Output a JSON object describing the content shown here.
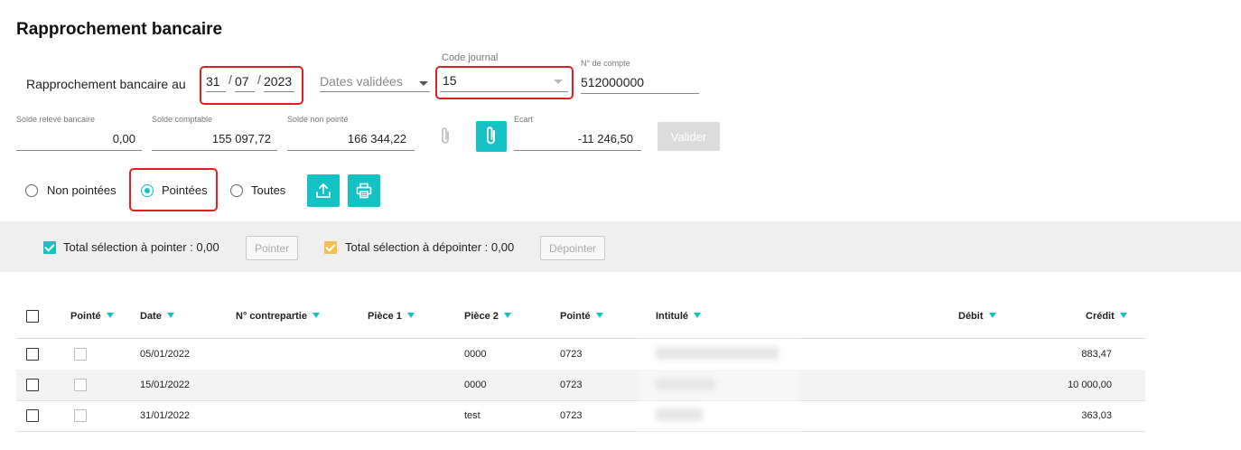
{
  "title": "Rapprochement bancaire",
  "header": {
    "label": "Rapprochement bancaire au",
    "date": {
      "day": "31",
      "month": "07",
      "year": "2023"
    },
    "dates_select_placeholder": "Dates validées",
    "code_journal_label": "Code journal",
    "code_journal_value": "15",
    "numero_compte_label": "N° de compte",
    "numero_compte_value": "512000000"
  },
  "soldes": {
    "releve_label": "Solde relevé bancaire",
    "releve_value": "0,00",
    "comptable_label": "Solde comptable",
    "comptable_value": "155 097,72",
    "non_pointe_label": "Solde non pointé",
    "non_pointe_value": "166 344,22",
    "ecart_label": "Ecart",
    "ecart_value": "-11 246,50",
    "valider_label": "Valider"
  },
  "filters": {
    "non_pointees": "Non pointées",
    "pointees": "Pointées",
    "toutes": "Toutes",
    "selected": "pointees"
  },
  "selection_bar": {
    "total_pointer": "Total sélection à pointer : 0,00",
    "pointer_button": "Pointer",
    "total_depointer": "Total sélection à dépointer : 0,00",
    "depointer_button": "Dépointer"
  },
  "table": {
    "columns": [
      "Pointé",
      "Date",
      "N° contrepartie",
      "Pièce 1",
      "Pièce 2",
      "Pointé",
      "Intitulé",
      "Débit",
      "Crédit"
    ],
    "rows": [
      {
        "date": "05/01/2022",
        "contrepartie": "",
        "piece1": "",
        "piece2": "0000",
        "pointe": "0723",
        "intitule": "",
        "debit": "",
        "credit": "883,47"
      },
      {
        "date": "15/01/2022",
        "contrepartie": "",
        "piece1": "",
        "piece2": "0000",
        "pointe": "0723",
        "intitule": "",
        "debit": "",
        "credit": "10 000,00"
      },
      {
        "date": "31/01/2022",
        "contrepartie": "",
        "piece1": "",
        "piece2": "test",
        "pointe": "0723",
        "intitule": "",
        "debit": "",
        "credit": "363,03"
      }
    ]
  },
  "colors": {
    "accent": "#14c2c5",
    "highlight": "#e02020",
    "depointer_check": "#f3c04e"
  },
  "icons": [
    "caret-down-icon",
    "paperclip-icon",
    "upload-icon",
    "print-icon",
    "sort-triangle-icon"
  ]
}
